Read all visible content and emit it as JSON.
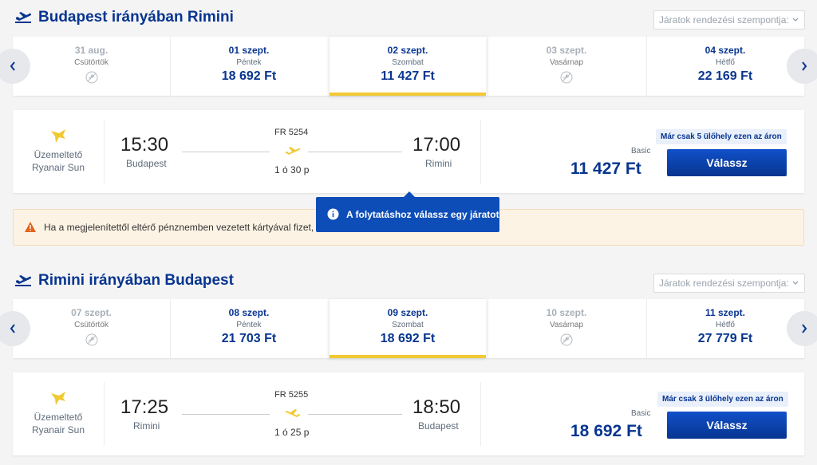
{
  "outbound": {
    "title": "Budapest irányában Rimini",
    "sort_placeholder": "Járatok rendezési szempontja:",
    "dates": [
      {
        "date": "31 aug.",
        "weekday": "Csütörtök",
        "price": "",
        "available": false
      },
      {
        "date": "01 szept.",
        "weekday": "Péntek",
        "price": "18 692 Ft",
        "available": true
      },
      {
        "date": "02 szept.",
        "weekday": "Szombat",
        "price": "11 427 Ft",
        "available": true,
        "selected": true
      },
      {
        "date": "03 szept.",
        "weekday": "Vasárnap",
        "price": "",
        "available": false
      },
      {
        "date": "04 szept.",
        "weekday": "Hétfő",
        "price": "22 169 Ft",
        "available": true
      }
    ],
    "flight": {
      "operator_line1": "Üzemeltető",
      "operator_line2": "Ryanair Sun",
      "departure_time": "15:30",
      "departure_city": "Budapest",
      "flight_number": "FR 5254",
      "duration": "1 ó 30 p",
      "arrival_time": "17:00",
      "arrival_city": "Rimini",
      "seats_badge": "Már csak 5 ülőhely ezen az áron",
      "fare_name": "Basic",
      "price": "11 427 Ft",
      "select_label": "Válassz"
    }
  },
  "warning_text": "Ha a megjelenítettől eltérő pénznemben vezetett kártyával fizet, a",
  "tooltip_text": "A folytatáshoz válassz egy járatot",
  "inbound": {
    "title": "Rimini irányában Budapest",
    "sort_placeholder": "Járatok rendezési szempontja:",
    "dates": [
      {
        "date": "07 szept.",
        "weekday": "Csütörtök",
        "price": "",
        "available": false
      },
      {
        "date": "08 szept.",
        "weekday": "Péntek",
        "price": "21 703 Ft",
        "available": true
      },
      {
        "date": "09 szept.",
        "weekday": "Szombat",
        "price": "18 692 Ft",
        "available": true,
        "selected": true
      },
      {
        "date": "10 szept.",
        "weekday": "Vasárnap",
        "price": "",
        "available": false
      },
      {
        "date": "11 szept.",
        "weekday": "Hétfő",
        "price": "27 779 Ft",
        "available": true
      }
    ],
    "flight": {
      "operator_line1": "Üzemeltető",
      "operator_line2": "Ryanair Sun",
      "departure_time": "17:25",
      "departure_city": "Rimini",
      "flight_number": "FR 5255",
      "duration": "1 ó 25 p",
      "arrival_time": "18:50",
      "arrival_city": "Budapest",
      "seats_badge": "Már csak 3 ülőhely ezen az áron",
      "fare_name": "Basic",
      "price": "18 692 Ft",
      "select_label": "Válassz"
    }
  },
  "colors": {
    "brand_blue": "#073590",
    "accent_yellow": "#f1c933",
    "tooltip_blue": "#0c4db8"
  },
  "icons": [
    "plane-depart-icon",
    "chevron-down-icon",
    "chevron-left-icon",
    "chevron-right-icon",
    "no-flight-icon",
    "ryanair-logo-icon",
    "plane-icon",
    "warning-icon",
    "info-icon"
  ]
}
